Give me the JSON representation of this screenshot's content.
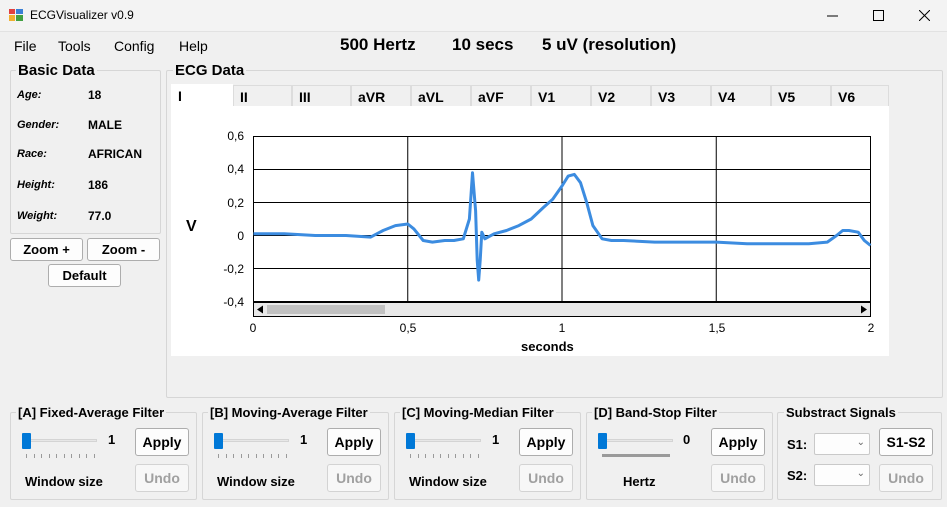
{
  "window": {
    "title": "ECGVisualizer v0.9"
  },
  "menu": [
    "File",
    "Tools",
    "Config",
    "Help"
  ],
  "status": {
    "sample_rate": "500 Hertz",
    "duration": "10 secs",
    "resolution": "5 uV (resolution)"
  },
  "basic_data": {
    "title": "Basic Data",
    "fields": [
      {
        "label": "Age:",
        "value": "18"
      },
      {
        "label": "Gender:",
        "value": "MALE"
      },
      {
        "label": "Race:",
        "value": "AFRICAN"
      },
      {
        "label": "Height:",
        "value": "186"
      },
      {
        "label": "Weight:",
        "value": "77.0"
      }
    ]
  },
  "zoom": {
    "in": "Zoom +",
    "out": "Zoom -",
    "default": "Default"
  },
  "ecg": {
    "title": "ECG Data",
    "tabs": [
      "I",
      "II",
      "III",
      "aVR",
      "aVL",
      "aVF",
      "V1",
      "V2",
      "V3",
      "V4",
      "V5",
      "V6"
    ],
    "active_tab": "I"
  },
  "chart_data": {
    "type": "line",
    "xlabel": "seconds",
    "ylabel": "V",
    "xlim": [
      0,
      2
    ],
    "ylim": [
      -0.4,
      0.6
    ],
    "xticks": [
      "0",
      "0,5",
      "1",
      "1,5",
      "2"
    ],
    "yticks": [
      "0,6",
      "0,4",
      "0,2",
      "0",
      "-0,2",
      "-0,4"
    ],
    "line_color": "#3c8ce0",
    "grid": true,
    "x": [
      0,
      0.1,
      0.2,
      0.3,
      0.38,
      0.42,
      0.46,
      0.5,
      0.52,
      0.55,
      0.58,
      0.62,
      0.65,
      0.68,
      0.7,
      0.71,
      0.72,
      0.725,
      0.73,
      0.735,
      0.74,
      0.75,
      0.78,
      0.82,
      0.86,
      0.9,
      0.94,
      0.97,
      1.0,
      1.02,
      1.04,
      1.06,
      1.08,
      1.1,
      1.13,
      1.16,
      1.2,
      1.3,
      1.4,
      1.5,
      1.6,
      1.7,
      1.8,
      1.86,
      1.89,
      1.91,
      1.93,
      1.96,
      1.98,
      2.0
    ],
    "y": [
      0.01,
      0.01,
      0.0,
      0.0,
      -0.01,
      0.03,
      0.06,
      0.07,
      0.04,
      -0.03,
      -0.04,
      -0.03,
      -0.03,
      -0.02,
      0.1,
      0.38,
      0.15,
      -0.15,
      -0.27,
      -0.15,
      0.02,
      -0.02,
      0.01,
      0.03,
      0.06,
      0.1,
      0.17,
      0.22,
      0.3,
      0.36,
      0.37,
      0.32,
      0.2,
      0.06,
      -0.02,
      -0.03,
      -0.03,
      -0.04,
      -0.04,
      -0.04,
      -0.05,
      -0.05,
      -0.05,
      -0.04,
      0.0,
      0.03,
      0.03,
      0.02,
      -0.03,
      -0.06
    ]
  },
  "filters": [
    {
      "title": "[A] Fixed-Average Filter",
      "value": "1",
      "caption": "Window size",
      "apply": "Apply",
      "undo": "Undo"
    },
    {
      "title": "[B] Moving-Average Filter",
      "value": "1",
      "caption": "Window size",
      "apply": "Apply",
      "undo": "Undo"
    },
    {
      "title": "[C] Moving-Median Filter",
      "value": "1",
      "caption": "Window size",
      "apply": "Apply",
      "undo": "Undo"
    },
    {
      "title": "[D] Band-Stop Filter",
      "value": "0",
      "caption": "Hertz",
      "apply": "Apply",
      "undo": "Undo"
    }
  ],
  "subtract": {
    "title": "Substract Signals",
    "s1": "S1:",
    "s2": "S2:",
    "button": "S1-S2",
    "undo": "Undo"
  }
}
